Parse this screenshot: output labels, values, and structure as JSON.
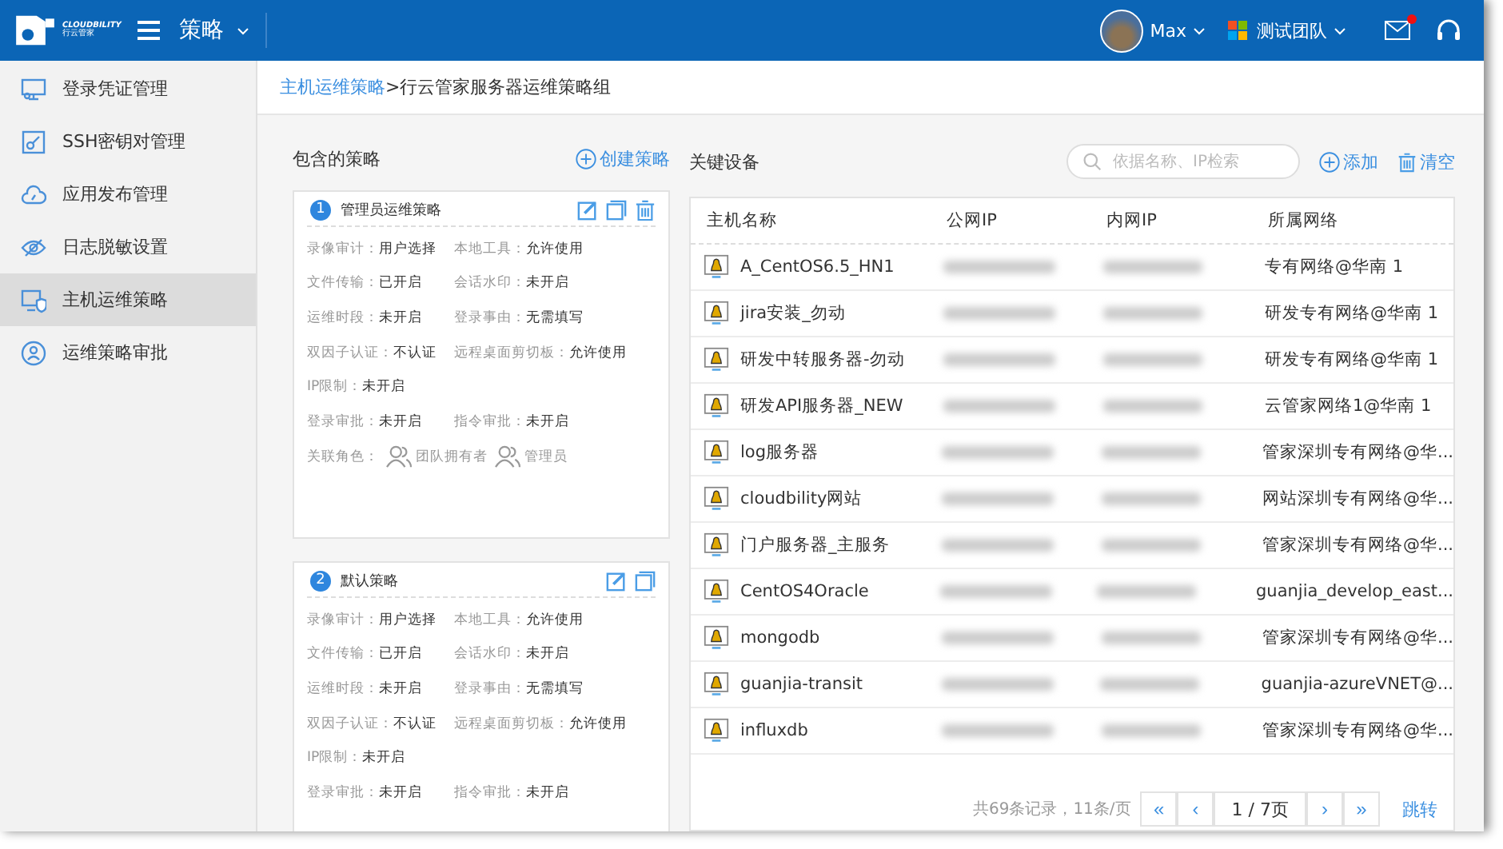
{
  "header": {
    "logo_text": "CLOUDBILITY",
    "logo_sub": "行云管家",
    "module": "策略",
    "user": "Max",
    "team": "测试团队",
    "has_unread": true
  },
  "sidebar": {
    "items": [
      {
        "label": "登录凭证管理",
        "kind": "credential",
        "selected": false
      },
      {
        "label": "SSH密钥对管理",
        "kind": "key",
        "selected": false
      },
      {
        "label": "应用发布管理",
        "kind": "cloud",
        "selected": false
      },
      {
        "label": "日志脱敏设置",
        "kind": "eye",
        "selected": false
      },
      {
        "label": "主机运维策略",
        "kind": "shield",
        "selected": true
      },
      {
        "label": "运维策略审批",
        "kind": "person",
        "selected": false
      }
    ]
  },
  "breadcrumb": {
    "link": "主机运维策略",
    "separator": ">",
    "current": "行云管家服务器运维策略组"
  },
  "policies": {
    "title": "包含的策略",
    "create": "创建策略",
    "cards": [
      {
        "index": "1",
        "name": "管理员运维策略",
        "deletable": true,
        "rows": [
          [
            {
              "label": "录像审计：",
              "value": "用户选择"
            },
            {
              "label": "本地工具：",
              "value": "允许使用"
            }
          ],
          [
            {
              "label": "文件传输：",
              "value": "已开启"
            },
            {
              "label": "会话水印：",
              "value": "未开启"
            }
          ],
          [
            {
              "label": "运维时段：",
              "value": "未开启"
            },
            {
              "label": "登录事由：",
              "value": "无需填写"
            }
          ],
          [
            {
              "label": "双因子认证：",
              "value": "不认证"
            },
            {
              "label": "远程桌面剪切板：",
              "value": "允许使用"
            }
          ],
          [
            {
              "label": "IP限制：",
              "value": "未开启"
            }
          ],
          [
            {
              "label": "登录审批：",
              "value": "未开启"
            },
            {
              "label": "指令审批：",
              "value": "未开启"
            }
          ]
        ],
        "roles_label": "关联角色：",
        "roles": [
          "团队拥有者",
          "管理员"
        ]
      },
      {
        "index": "2",
        "name": "默认策略",
        "deletable": false,
        "rows": [
          [
            {
              "label": "录像审计：",
              "value": "用户选择"
            },
            {
              "label": "本地工具：",
              "value": "允许使用"
            }
          ],
          [
            {
              "label": "文件传输：",
              "value": "已开启"
            },
            {
              "label": "会话水印：",
              "value": "未开启"
            }
          ],
          [
            {
              "label": "运维时段：",
              "value": "未开启"
            },
            {
              "label": "登录事由：",
              "value": "无需填写"
            }
          ],
          [
            {
              "label": "双因子认证：",
              "value": "不认证"
            },
            {
              "label": "远程桌面剪切板：",
              "value": "允许使用"
            }
          ],
          [
            {
              "label": "IP限制：",
              "value": "未开启"
            }
          ],
          [
            {
              "label": "登录审批：",
              "value": "未开启"
            },
            {
              "label": "指令审批：",
              "value": "未开启"
            }
          ]
        ]
      }
    ]
  },
  "devices": {
    "title": "关键设备",
    "search": {
      "placeholder": "依据名称、IP检索"
    },
    "add": "添加",
    "clear": "清空",
    "table": {
      "columns": [
        "主机名称",
        "公网IP",
        "内网IP",
        "所属网络"
      ],
      "rows": [
        {
          "name": "A_CentOS6.5_HN1",
          "network": "专有网络@华南 1"
        },
        {
          "name": "jira安装_勿动",
          "network": "研发专有网络@华南 1"
        },
        {
          "name": "研发中转服务器-勿动",
          "network": "研发专有网络@华南 1"
        },
        {
          "name": "研发API服务器_NEW",
          "network": "云管家网络1@华南 1"
        },
        {
          "name": "log服务器",
          "network": "管家深圳专有网络@华..."
        },
        {
          "name": "cloudbility网站",
          "network": "网站深圳专有网络@华..."
        },
        {
          "name": "门户服务器_主服务",
          "network": "管家深圳专有网络@华..."
        },
        {
          "name": "CentOS4Oracle",
          "network": "guanjia_develop_east..."
        },
        {
          "name": "mongodb",
          "network": "管家深圳专有网络@华..."
        },
        {
          "name": "guanjia-transit",
          "network": "guanjia-azureVNET@..."
        },
        {
          "name": "influxdb",
          "network": "管家深圳专有网络@华..."
        }
      ]
    },
    "pagination": {
      "summary": "共69条记录，11条/页",
      "first": "«",
      "prev": "‹",
      "page": "1 / 7页",
      "next": "›",
      "last": "»",
      "jump": "跳转"
    }
  }
}
